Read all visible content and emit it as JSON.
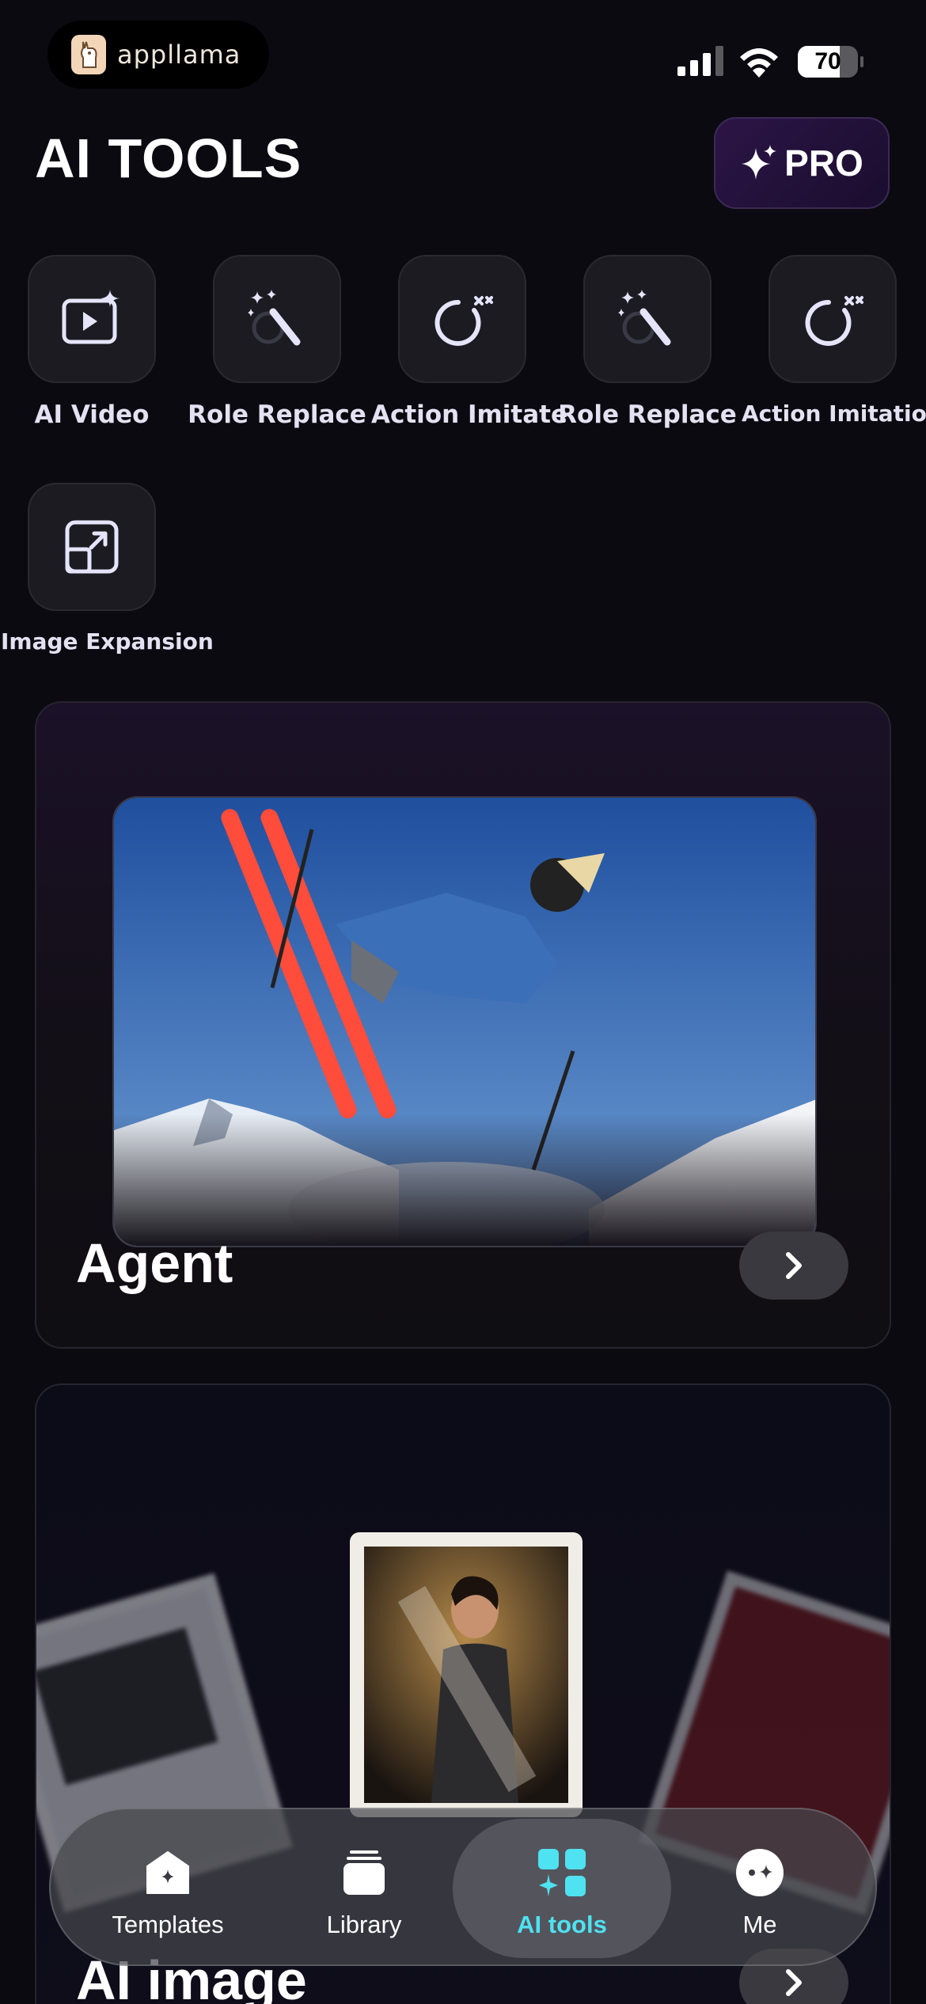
{
  "status_bar": {
    "brand_name": "appllama",
    "battery_level": 70,
    "battery_text": "70"
  },
  "header": {
    "title": "AI TOOLS",
    "pro_label": "PRO"
  },
  "tools": [
    {
      "label": "AI Video",
      "icon": "video-sparkle-icon"
    },
    {
      "label": "Role Replace",
      "icon": "magic-wand-icon"
    },
    {
      "label": "Action Imitate",
      "icon": "refresh-sparkle-icon"
    },
    {
      "label": "Role Replace",
      "icon": "magic-wand-icon"
    },
    {
      "label": "Action Imitation",
      "icon": "refresh-sparkle-icon"
    },
    {
      "label": "Image Expansion",
      "icon": "expand-icon"
    }
  ],
  "cards": {
    "agent_title": "Agent",
    "image_title": "AI image"
  },
  "tab_bar": {
    "items": [
      {
        "label": "Templates",
        "icon": "templates-icon"
      },
      {
        "label": "Library",
        "icon": "library-icon"
      },
      {
        "label": "AI tools",
        "icon": "ai-tools-icon",
        "active": true
      },
      {
        "label": "Me",
        "icon": "me-icon"
      }
    ]
  },
  "colors": {
    "background": "#0b0a10",
    "accent_cyan": "#4fe2f0",
    "pro_purple": "#2c1546"
  }
}
